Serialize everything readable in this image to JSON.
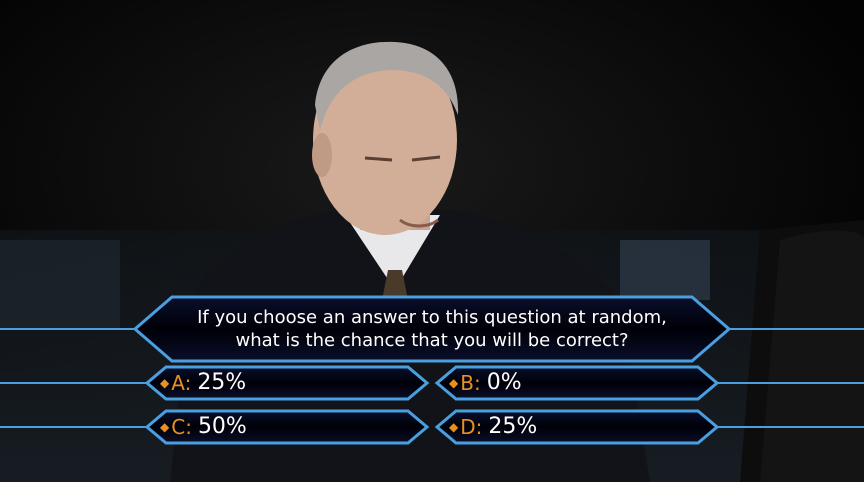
{
  "question": {
    "line1": "If you choose an answer to this question at random,",
    "line2": "what is the chance that you will be correct?"
  },
  "answers": [
    {
      "letter": "A:",
      "text": "25%"
    },
    {
      "letter": "B:",
      "text": "0%"
    },
    {
      "letter": "C:",
      "text": "50%"
    },
    {
      "letter": "D:",
      "text": "25%"
    }
  ],
  "colors": {
    "border": "#4a9fe0",
    "panel": "#000008",
    "accent": "#e9901f",
    "text": "#ffffff"
  }
}
